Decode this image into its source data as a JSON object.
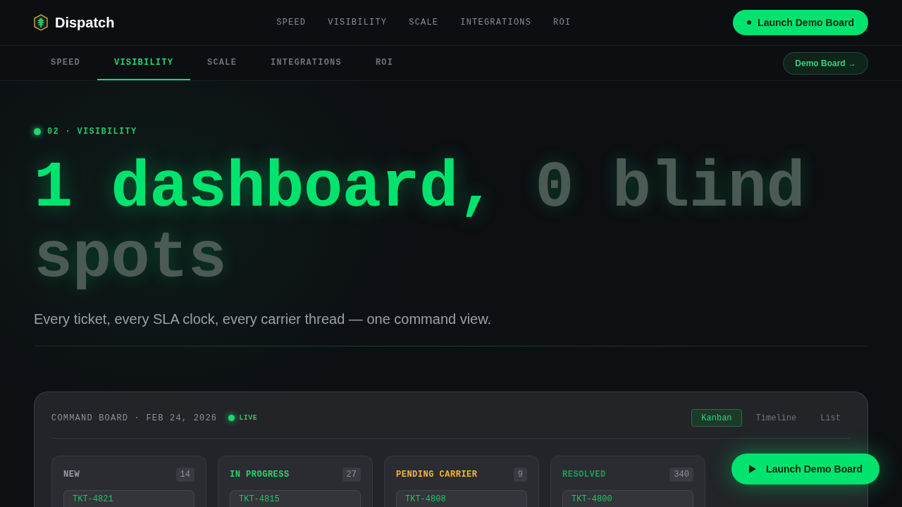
{
  "header": {
    "brand": "Dispatch",
    "nav": [
      {
        "label": "SPEED"
      },
      {
        "label": "VISIBILITY"
      },
      {
        "label": "SCALE"
      },
      {
        "label": "INTEGRATIONS"
      },
      {
        "label": "ROI"
      }
    ],
    "cta": "Launch Demo Board"
  },
  "section_tabs": {
    "tabs": [
      {
        "label": "SPEED",
        "selected": false
      },
      {
        "label": "VISIBILITY",
        "selected": true
      },
      {
        "label": "SCALE",
        "selected": false
      },
      {
        "label": "INTEGRATIONS",
        "selected": false
      },
      {
        "label": "ROI",
        "selected": false
      }
    ],
    "button": "Demo Board →"
  },
  "hero": {
    "eyebrow": "02 · VISIBILITY",
    "headline": {
      "highlight": "1 dashboard,",
      "rest": "0 blind spots"
    },
    "subtitle": "Every ticket, every SLA clock, every carrier thread — one command view."
  },
  "board": {
    "title": "COMMAND BOARD · FEB 24, 2026",
    "status": "LIVE",
    "views": [
      {
        "label": "Kanban",
        "selected": true
      },
      {
        "label": "Timeline",
        "selected": false
      },
      {
        "label": "List",
        "selected": false
      }
    ],
    "columns": [
      {
        "name": "NEW",
        "count": "14",
        "color": "#9a9ca3",
        "tickets": [
          {
            "id": "TKT-4821"
          }
        ]
      },
      {
        "name": "IN PROGRESS",
        "count": "27",
        "color": "#22d86b",
        "tickets": [
          {
            "id": "TKT-4815"
          }
        ]
      },
      {
        "name": "PENDING CARRIER",
        "count": "9",
        "color": "#f5b82e",
        "tickets": [
          {
            "id": "TKT-4808"
          }
        ]
      },
      {
        "name": "RESOLVED",
        "count": "340",
        "color": "#1f9e5a",
        "tickets": [
          {
            "id": "TKT-4800"
          }
        ]
      }
    ]
  },
  "floating_button": {
    "label": "Launch Demo Board"
  }
}
